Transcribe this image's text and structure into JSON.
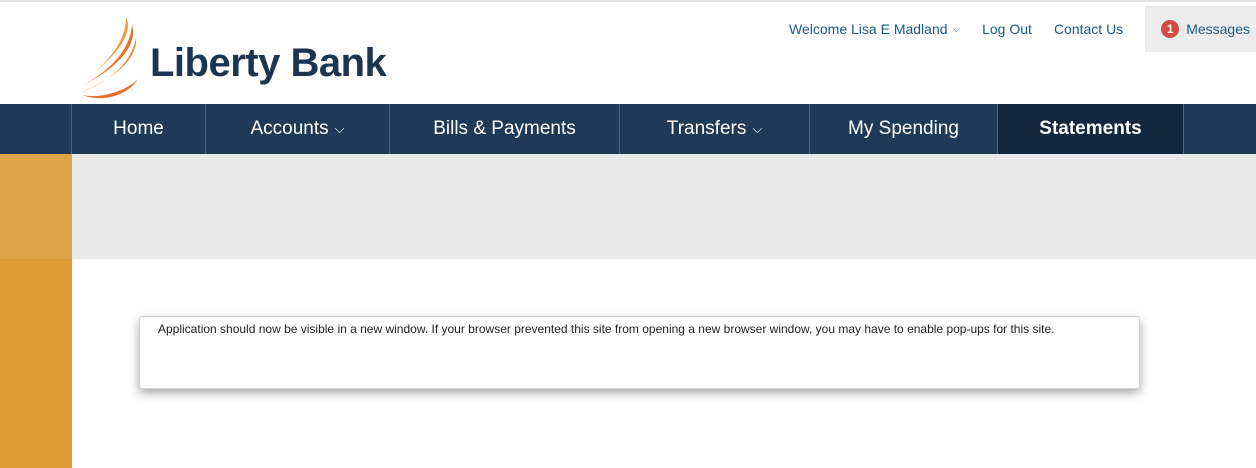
{
  "brand": {
    "name": "Liberty Bank",
    "logo_icon": "sail-flame-logo",
    "colors": {
      "navy": "#1e3a56",
      "orange": "#e8702a",
      "link_blue": "#1b5a86",
      "badge_red": "#d24b43",
      "side_orange": "#de9a35"
    }
  },
  "utility": {
    "welcome": "Welcome Lisa E Madland",
    "logout": "Log Out",
    "contact": "Contact Us",
    "messages_count": "1",
    "messages": "Messages"
  },
  "nav": {
    "home": "Home",
    "accounts": "Accounts",
    "bills": "Bills & Payments",
    "transfers": "Transfers",
    "spending": "My Spending",
    "statements": "Statements",
    "active": "Statements"
  },
  "notice": {
    "text": "Application should now be visible in a new window. If your browser prevented this site from opening a new browser window, you may have to enable pop-ups for this site."
  }
}
